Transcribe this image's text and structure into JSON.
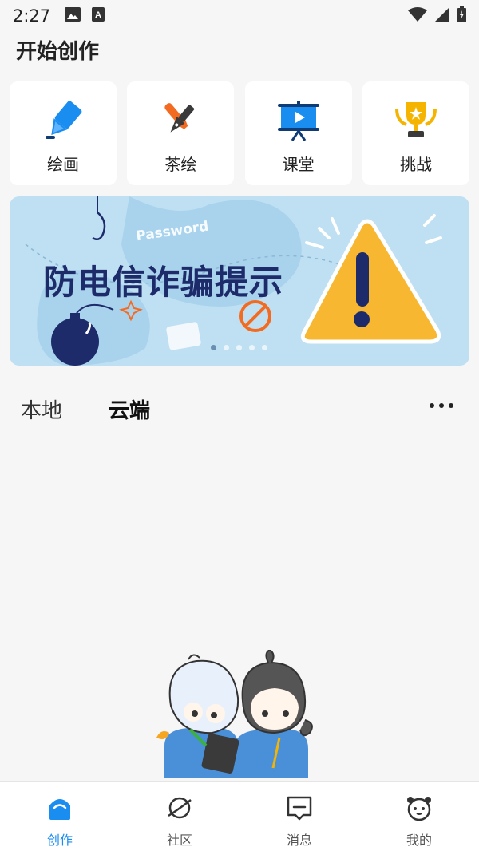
{
  "status_bar": {
    "time": "2:27",
    "icons_left": [
      "image-icon",
      "a-notification-icon"
    ],
    "icons_right": [
      "wifi-icon",
      "signal-icon",
      "battery-icon"
    ]
  },
  "page_title": "开始创作",
  "cards": [
    {
      "label": "绘画",
      "icon": "pen-nib-icon",
      "color": "#1a8df0"
    },
    {
      "label": "茶绘",
      "icon": "brush-pen-icon",
      "color": "#f26b21"
    },
    {
      "label": "课堂",
      "icon": "presentation-board-icon",
      "color": "#1a8df0"
    },
    {
      "label": "挑战",
      "icon": "trophy-icon",
      "color": "#f5b400"
    }
  ],
  "banner": {
    "title": "防电信诈骗提示",
    "password_text": "Password",
    "slide_index": 1,
    "slide_count": 5
  },
  "tabs": [
    {
      "label": "本地",
      "active": false
    },
    {
      "label": "云端",
      "active": true
    }
  ],
  "bottom_nav": [
    {
      "label": "创作",
      "icon": "create-home-icon",
      "active": true
    },
    {
      "label": "社区",
      "icon": "planet-icon",
      "active": false
    },
    {
      "label": "消息",
      "icon": "message-icon",
      "active": false
    },
    {
      "label": "我的",
      "icon": "panda-face-icon",
      "active": false
    }
  ],
  "colors": {
    "accent": "#1a8df0",
    "background": "#f6f6f6",
    "banner_bg": "#bfe0f2",
    "banner_title": "#1d2b6b",
    "warning": "#f7b731"
  }
}
